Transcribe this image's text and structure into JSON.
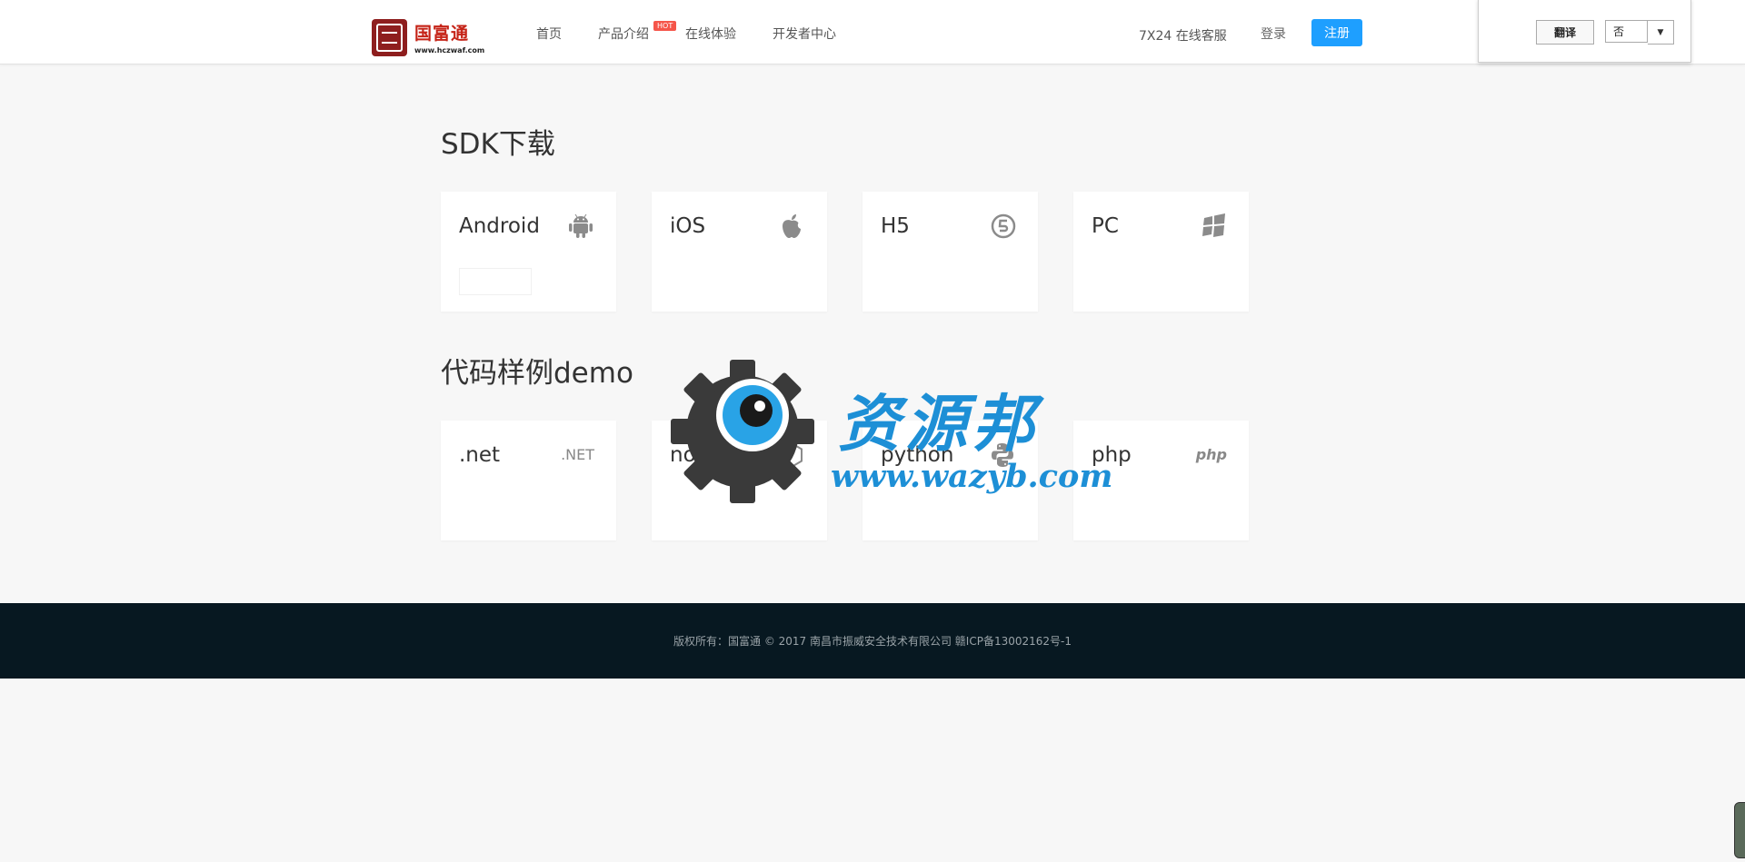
{
  "header": {
    "logo": {
      "name": "国富通",
      "url": "www.hczwaf.com"
    },
    "nav": [
      {
        "label": "首页"
      },
      {
        "label": "产品介绍"
      },
      {
        "label": "在线体验"
      },
      {
        "label": "开发者中心"
      }
    ],
    "hot_badge": "HOT",
    "service": "7X24 在线客服",
    "login": "登录",
    "register": "注册",
    "accent_color": "#1e9fff"
  },
  "translate_widget": {
    "button": "翻译",
    "selected": "否"
  },
  "sdk": {
    "title": "SDK下载",
    "cards": [
      {
        "label": "Android",
        "icon": "android-icon"
      },
      {
        "label": "iOS",
        "icon": "apple-icon"
      },
      {
        "label": "H5",
        "icon": "html5-icon"
      },
      {
        "label": "PC",
        "icon": "windows-icon"
      }
    ]
  },
  "demo": {
    "title": "代码样例demo",
    "cards": [
      {
        "label": ".net",
        "icon": "dotnet-icon",
        "icon_text": ".NET"
      },
      {
        "label": "node.js",
        "icon": "nodejs-icon"
      },
      {
        "label": "python",
        "icon": "python-icon"
      },
      {
        "label": "php",
        "icon": "php-icon",
        "icon_text": "php"
      }
    ]
  },
  "watermark": {
    "title": "资源邦",
    "url": "www.wazyb.com",
    "color": "#1d8fd6"
  },
  "footer": {
    "text": "版权所有：国富通 © 2017 南昌市振威安全技术有限公司 赣ICP备13002162号-1",
    "background": "#071821"
  }
}
